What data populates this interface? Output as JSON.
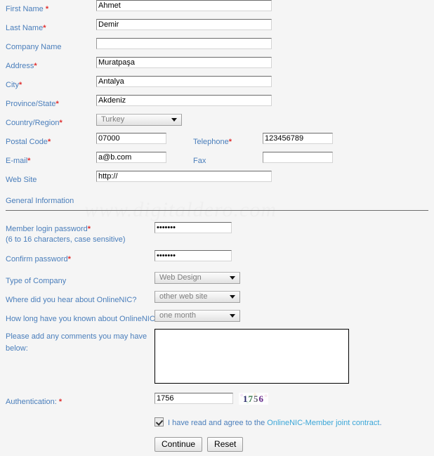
{
  "watermark": "www.digitaldero.com",
  "colors": {
    "label": "#4a7ebb",
    "required": "#e03030",
    "link": "#3aa6d8",
    "background": "#f5f5f5"
  },
  "contact_section": {
    "fields": [
      {
        "label": "First Name ",
        "required": "*",
        "value": "Ahmet",
        "placeholder": ""
      },
      {
        "label": "Last Name",
        "required": "*",
        "value": "Demir",
        "placeholder": ""
      },
      {
        "label": "Company Name",
        "required": "",
        "value": "",
        "placeholder": ""
      },
      {
        "label": "Address",
        "required": "*",
        "value": "Muratpaşa",
        "placeholder": ""
      },
      {
        "label": "City",
        "required": "*",
        "value": "Antalya",
        "placeholder": ""
      },
      {
        "label": "Province/State",
        "required": "*",
        "value": "Akdeniz",
        "placeholder": ""
      }
    ],
    "country": {
      "label": "Country/Region",
      "required": "*",
      "value": "Turkey"
    },
    "postal": {
      "label": "Postal Code",
      "required": "*",
      "value": "07000",
      "placeholder": ""
    },
    "telephone": {
      "label": "Telephone",
      "required": "*",
      "value": "123456789",
      "placeholder": ""
    },
    "email": {
      "label": "E-mail",
      "required": "*",
      "value": "a@b.com",
      "placeholder": ""
    },
    "fax": {
      "label": "Fax",
      "required": "",
      "value": "",
      "placeholder": ""
    },
    "website": {
      "label": "Web Site",
      "required": "",
      "value": "http://",
      "placeholder": ""
    }
  },
  "general_section": {
    "heading": "General Information",
    "password": {
      "label": "Member login password",
      "required": "*",
      "hint": "(6 to 16 characters, case sensitive)",
      "value": "•••••••"
    },
    "confirm_password": {
      "label": "Confirm password",
      "required": "*",
      "value": "•••••••"
    },
    "type_of_company": {
      "label": "Type of Company",
      "required": "",
      "value": "Web Design"
    },
    "where_heard": {
      "label": "Where did you hear about OnlineNIC?",
      "required": "",
      "value": "other web site"
    },
    "how_long": {
      "label": "How long have you known about OnlineNIC?",
      "required": "",
      "value": "one month"
    },
    "comments": {
      "label_line1": "Please add any comments you may have",
      "label_line2": "below:",
      "value": "",
      "placeholder": ""
    }
  },
  "authentication": {
    "label": "Authentication: ",
    "required": "*",
    "value": "1756",
    "placeholder": "",
    "captcha_code": "1756",
    "captcha_digits": [
      "1",
      "7",
      "5",
      "6"
    ]
  },
  "agreement": {
    "checked": true,
    "text_before": "I have read and agree to the ",
    "link_text": "OnlineNIC-Member joint contract",
    "text_after": "."
  },
  "buttons": {
    "continue": "Continue",
    "reset": "Reset"
  }
}
